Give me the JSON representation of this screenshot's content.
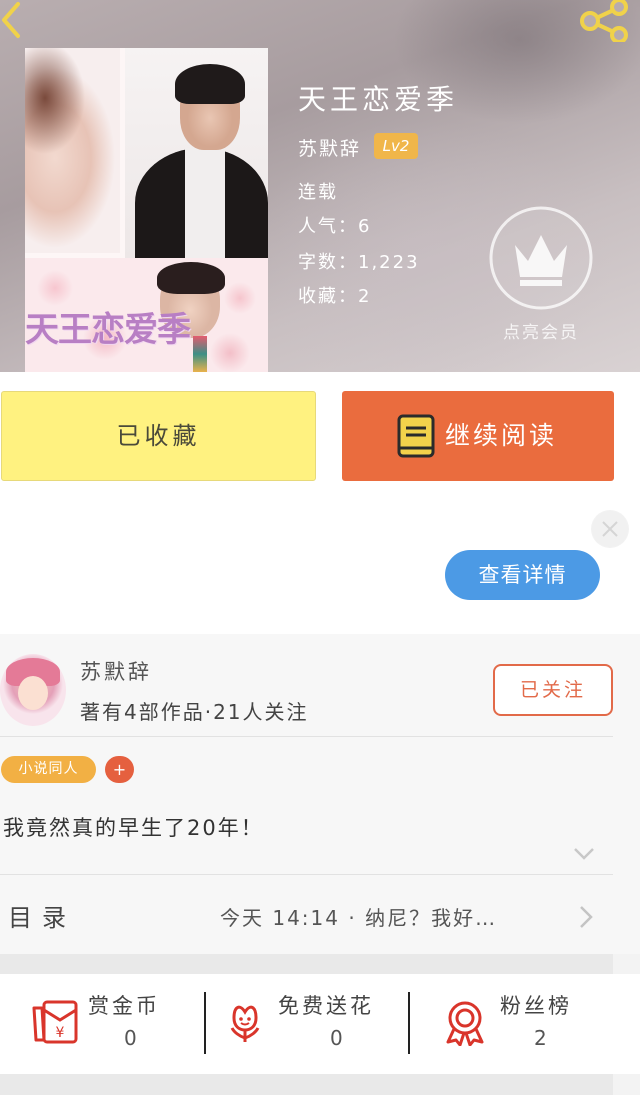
{
  "book": {
    "title": "天王恋爱季",
    "cover_title": "天王恋爱季",
    "author": "苏默辞",
    "level": "Lv2",
    "status": "连载",
    "popularity": "人气：6",
    "word_count": "字数：1,223",
    "favorites": "收藏：2",
    "vip_label": "点亮会员"
  },
  "actions": {
    "collected_label": "已收藏",
    "continue_label": "继续阅读"
  },
  "ad": {
    "details_label": "查看详情"
  },
  "author_card": {
    "name": "苏默辞",
    "stats": "著有4部作品·21人关注",
    "follow_label": "已关注",
    "tag": "小说同人",
    "tag_add": "+",
    "intro": "我竟然真的早生了20年！"
  },
  "toc": {
    "label": "目录",
    "latest": "今天  14:14  ·  纳尼？我好…"
  },
  "stats": {
    "reward": {
      "label": "赏金币",
      "value": "0"
    },
    "flowers": {
      "label": "免费送花",
      "value": "0"
    },
    "fans": {
      "label": "粉丝榜",
      "value": "2"
    }
  },
  "colors": {
    "accent_orange": "#ea6c3e",
    "collected_yellow": "#fff280",
    "details_blue": "#4c9ae5",
    "level_badge": "#f0b64a",
    "icon_red": "#d9352b"
  },
  "icons": [
    "back-icon",
    "share-icon",
    "crown-icon",
    "book-icon",
    "close-icon",
    "expand-chevron-icon",
    "chevron-right-icon",
    "red-envelope-icon",
    "flower-icon",
    "medal-icon"
  ]
}
